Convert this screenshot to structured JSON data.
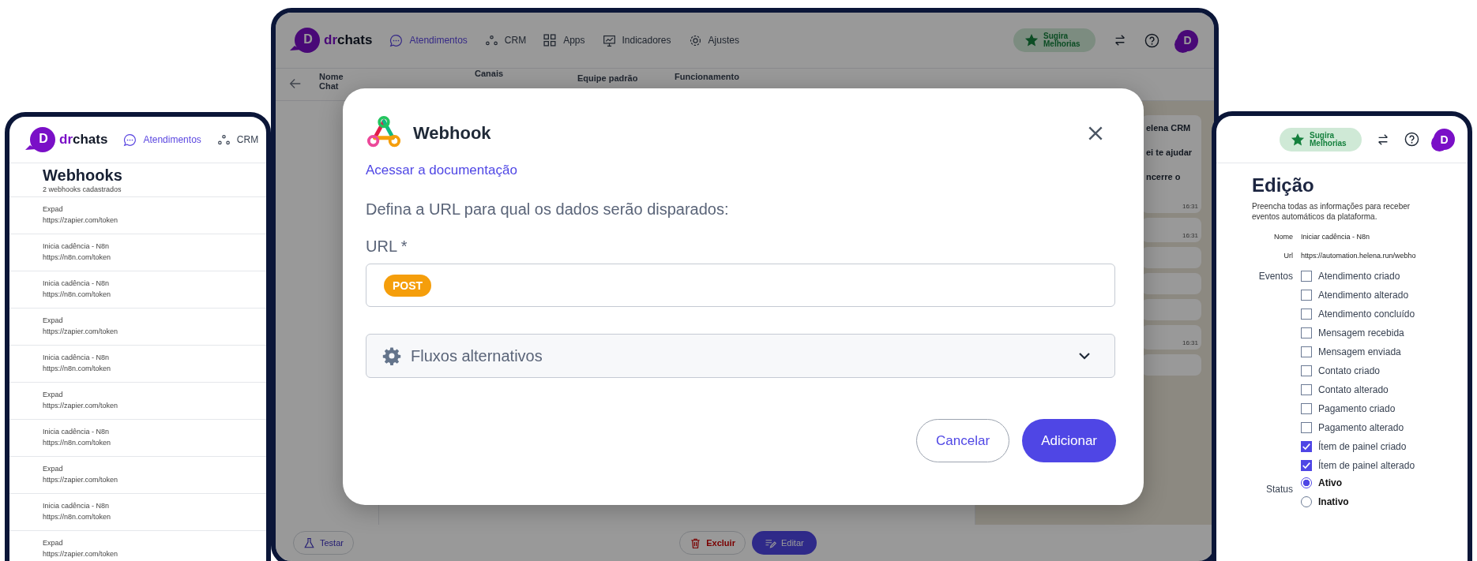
{
  "left_window": {
    "logo": {
      "mark": "D",
      "word_1": "dr",
      "word_2": "chats"
    },
    "nav": [
      {
        "label": "Atendimentos",
        "selected": true
      },
      {
        "label": "CRM",
        "selected": false
      }
    ],
    "title": "Webhooks",
    "subtitle": "2 webhooks cadastrados",
    "webhooks": [
      {
        "name": "Expad",
        "url": "https://zapier.com/token"
      },
      {
        "name": "Inicia cadência - N8n",
        "url": "https://n8n.com/token"
      },
      {
        "name": "Inicia cadência - N8n",
        "url": "https://n8n.com/token"
      },
      {
        "name": "Expad",
        "url": "https://zapier.com/token"
      },
      {
        "name": "Inicia cadência - N8n",
        "url": "https://n8n.com/token"
      },
      {
        "name": "Expad",
        "url": "https://zapier.com/token"
      },
      {
        "name": "Inicia cadência - N8n",
        "url": "https://n8n.com/token"
      },
      {
        "name": "Expad",
        "url": "https://zapier.com/token"
      },
      {
        "name": "Inicia cadência - N8n",
        "url": "https://n8n.com/token"
      },
      {
        "name": "Expad",
        "url": "https://zapier.com/token"
      }
    ]
  },
  "main_window": {
    "logo": {
      "mark": "D",
      "word_1": "dr",
      "word_2": "chats"
    },
    "nav": [
      {
        "label": "Atendimentos",
        "selected": true
      },
      {
        "label": "CRM",
        "selected": false
      },
      {
        "label": "Apps",
        "selected": false
      },
      {
        "label": "Indicadores",
        "selected": false
      },
      {
        "label": "Ajustes",
        "selected": false
      }
    ],
    "suggest_button": "Sugira Melhorias",
    "avatar": "D",
    "columns": [
      "Nome Chat",
      "Canais",
      "Equipe padrão",
      "Funcionamento"
    ],
    "chat_bubbles": [
      {
        "kind": "message",
        "lines": [
          "elena CRM",
          "ei te ajudar",
          "ncerre o"
        ],
        "time": "16:31"
      },
      {
        "kind": "message",
        "time": "16:31"
      },
      {
        "kind": "stub"
      },
      {
        "kind": "stub"
      },
      {
        "kind": "stub"
      },
      {
        "kind": "message",
        "time": "16:31"
      },
      {
        "kind": "stub"
      }
    ],
    "footer_buttons": [
      {
        "label": "Testar",
        "kind": "outline"
      },
      {
        "label": "Excluir",
        "kind": "danger"
      },
      {
        "label": "Editar",
        "kind": "primary"
      }
    ]
  },
  "modal": {
    "title": "Webhook",
    "doc_link": "Acessar a documentação",
    "instruction": "Defina a URL para qual os dados serão disparados:",
    "url_label": "URL *",
    "method": "POST",
    "accordion": {
      "label": "Fluxos alternativos",
      "expanded": false
    },
    "buttons": [
      {
        "label": "Cancelar",
        "kind": "secondary"
      },
      {
        "label": "Adicionar",
        "kind": "primary"
      }
    ]
  },
  "right_window": {
    "suggest_button": "Sugira Melhorias",
    "avatar": "D",
    "title": "Edição",
    "description": "Preencha todas as informações para receber eventos automáticos da plataforma.",
    "fields": [
      {
        "label": "Nome",
        "value": "Iniciar cadência - N8n"
      },
      {
        "label": "Url",
        "value": "https://automation.helena.run/webho"
      }
    ],
    "events_label": "Eventos",
    "events": [
      {
        "label": "Atendimento criado",
        "checked": false
      },
      {
        "label": "Atendimento alterado",
        "checked": false
      },
      {
        "label": "Atendimento concluído",
        "checked": false
      },
      {
        "label": "Mensagem recebida",
        "checked": false
      },
      {
        "label": "Mensagem enviada",
        "checked": false
      },
      {
        "label": "Contato criado",
        "checked": false
      },
      {
        "label": "Contato alterado",
        "checked": false
      },
      {
        "label": "Pagamento criado",
        "checked": false
      },
      {
        "label": "Pagamento alterado",
        "checked": false
      },
      {
        "label": "Ítem de painel criado",
        "checked": true
      },
      {
        "label": "Ítem de painel alterado",
        "checked": true
      }
    ],
    "status_label": "Status",
    "status_options": [
      {
        "label": "Ativo",
        "selected": true
      },
      {
        "label": "Inativo",
        "selected": false
      }
    ]
  }
}
